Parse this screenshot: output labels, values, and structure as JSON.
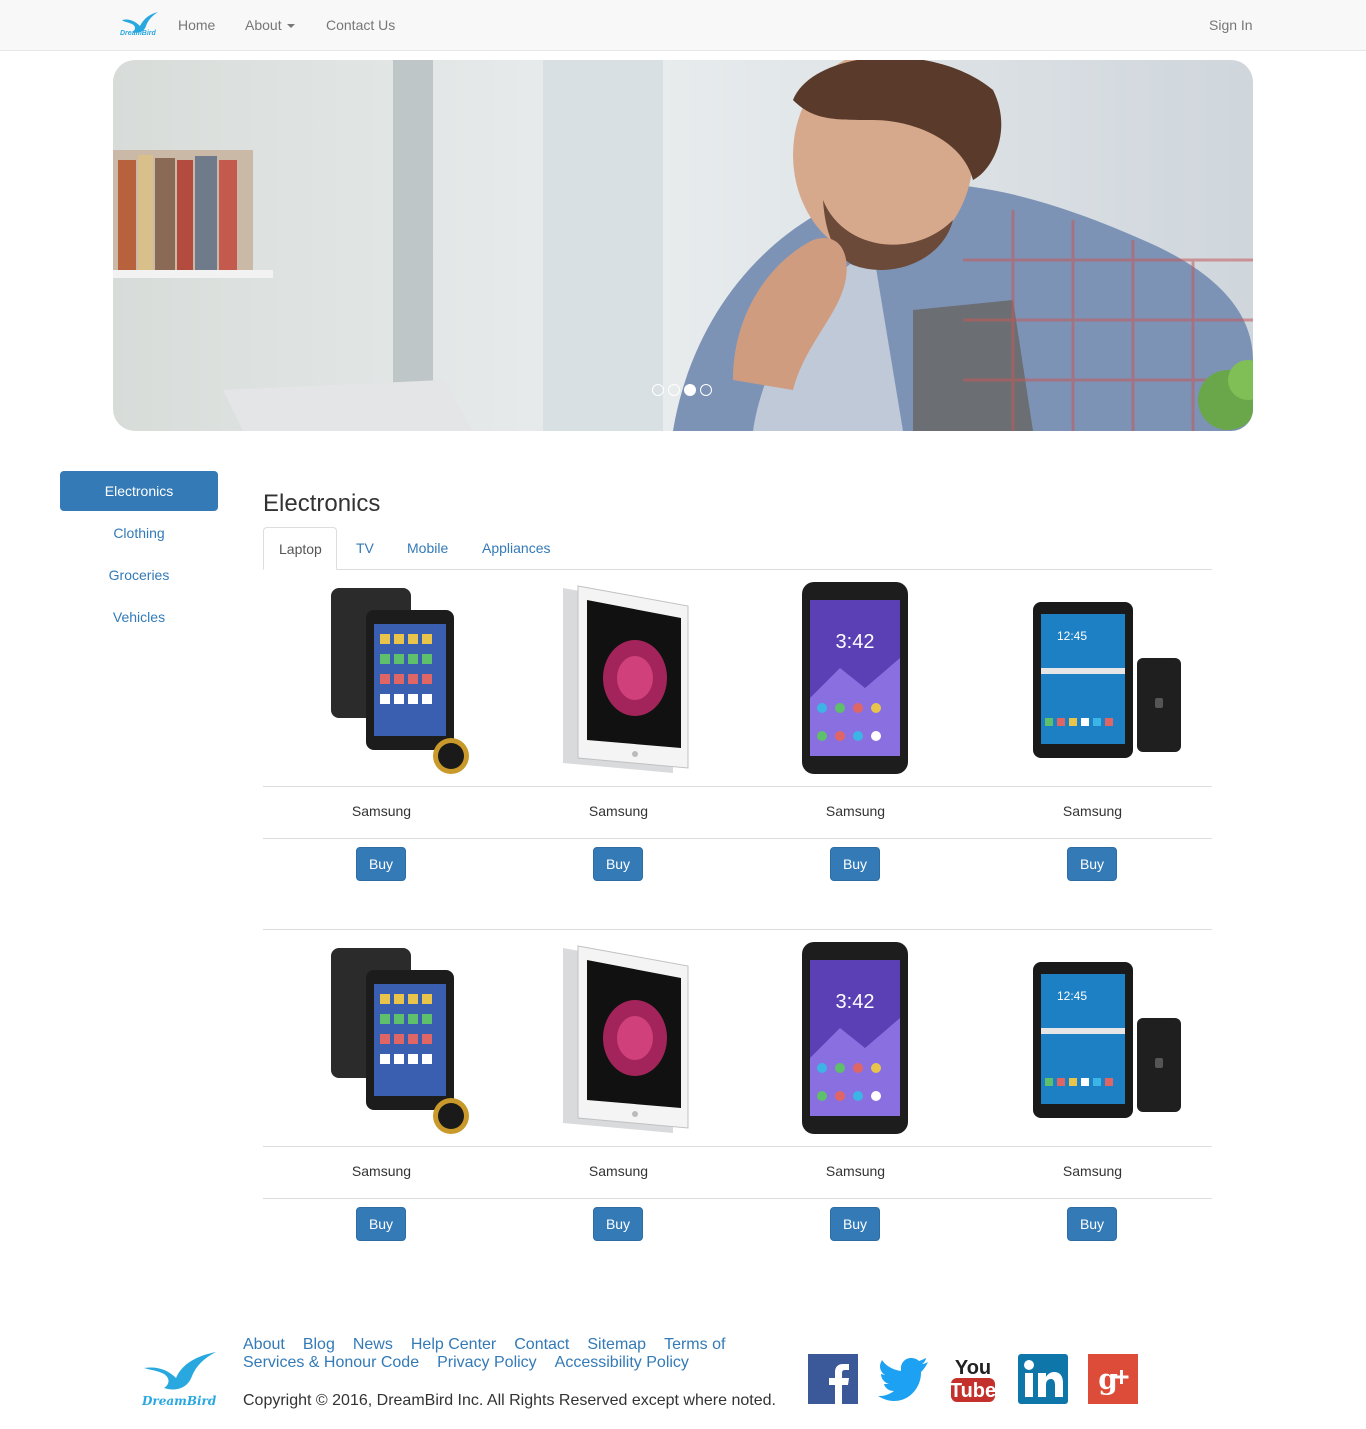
{
  "navbar": {
    "brand": "DreamBird",
    "links": [
      "Home",
      "About",
      "Contact Us"
    ],
    "sign_in": "Sign In"
  },
  "carousel": {
    "slide_count": 4,
    "active_slide": 3
  },
  "sidebar": {
    "items": [
      "Electronics",
      "Clothing",
      "Groceries",
      "Vehicles"
    ],
    "active": "Electronics"
  },
  "main": {
    "title": "Electronics",
    "tabs": [
      "Laptop",
      "TV",
      "Mobile",
      "Appliances"
    ],
    "active_tab": "Laptop",
    "rows": [
      {
        "products": [
          {
            "name": "Samsung",
            "image": "kindle-tablet",
            "buy": "Buy"
          },
          {
            "name": "Samsung",
            "image": "silver-tablet",
            "buy": "Buy"
          },
          {
            "name": "Samsung",
            "image": "android-phone",
            "buy": "Buy"
          },
          {
            "name": "Samsung",
            "image": "samsung-tab",
            "buy": "Buy"
          }
        ]
      },
      {
        "products": [
          {
            "name": "Samsung",
            "image": "kindle-tablet",
            "buy": "Buy"
          },
          {
            "name": "Samsung",
            "image": "silver-tablet",
            "buy": "Buy"
          },
          {
            "name": "Samsung",
            "image": "android-phone",
            "buy": "Buy"
          },
          {
            "name": "Samsung",
            "image": "samsung-tab",
            "buy": "Buy"
          }
        ]
      }
    ]
  },
  "footer": {
    "links": [
      "About",
      "Blog",
      "News",
      "Help Center",
      "Contact",
      "Sitemap",
      "Terms of Services & Honour Code",
      "Privacy Policy",
      "Accessibility Policy"
    ],
    "copyright": "Copyright © 2016, DreamBird Inc. All Rights Reserved except where noted.",
    "social": [
      "facebook-icon",
      "twitter-icon",
      "youtube-icon",
      "linkedin-icon",
      "google-plus-icon"
    ],
    "logo_text": "DreamBird"
  },
  "colors": {
    "primary": "#337ab7",
    "nav_bg": "#f8f8f8"
  }
}
